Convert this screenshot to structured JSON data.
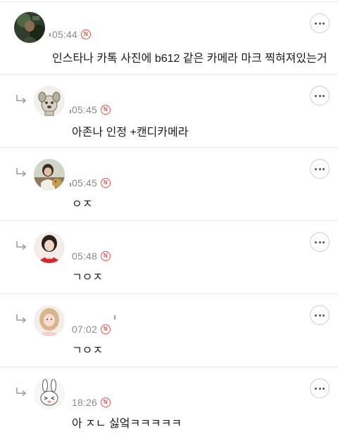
{
  "comments": [
    {
      "time": "05:44",
      "badge": "N",
      "text": "인스타나 카톡 사진에 b612 같은 카메라 마크 찍혀져있는거",
      "is_reply": false,
      "avatar_icon": "profile-photo-dark-green"
    },
    {
      "time": "05:45",
      "badge": "N",
      "text": "아존나 인정 +캔디카메라",
      "is_reply": true,
      "avatar_icon": "profile-dog-drawing"
    },
    {
      "time": "05:45",
      "badge": "N",
      "text": "ㅇㅈ",
      "is_reply": true,
      "avatar_icon": "profile-person-with-dog"
    },
    {
      "time": "05:48",
      "badge": "N",
      "text": "ㄱㅇㅈ",
      "is_reply": true,
      "avatar_icon": "profile-person-red-sweater"
    },
    {
      "time": "07:02",
      "badge": "N",
      "text": "ㄱㅇㅈ",
      "is_reply": true,
      "avatar_icon": "profile-person-blonde"
    },
    {
      "time": "18:26",
      "badge": "N",
      "text": "아 ㅈㄴ 싫엌ㅋㅋㅋㅋㅋ",
      "is_reply": true,
      "avatar_icon": "profile-bunny-cartoon"
    }
  ],
  "icons": {
    "reply": "reply-arrow-icon",
    "more": "more-options-icon",
    "new": "new-badge-icon"
  },
  "colors": {
    "badge": "#ef4b46",
    "meta_text": "#8a8a8a",
    "divider": "#e6e6e6"
  }
}
